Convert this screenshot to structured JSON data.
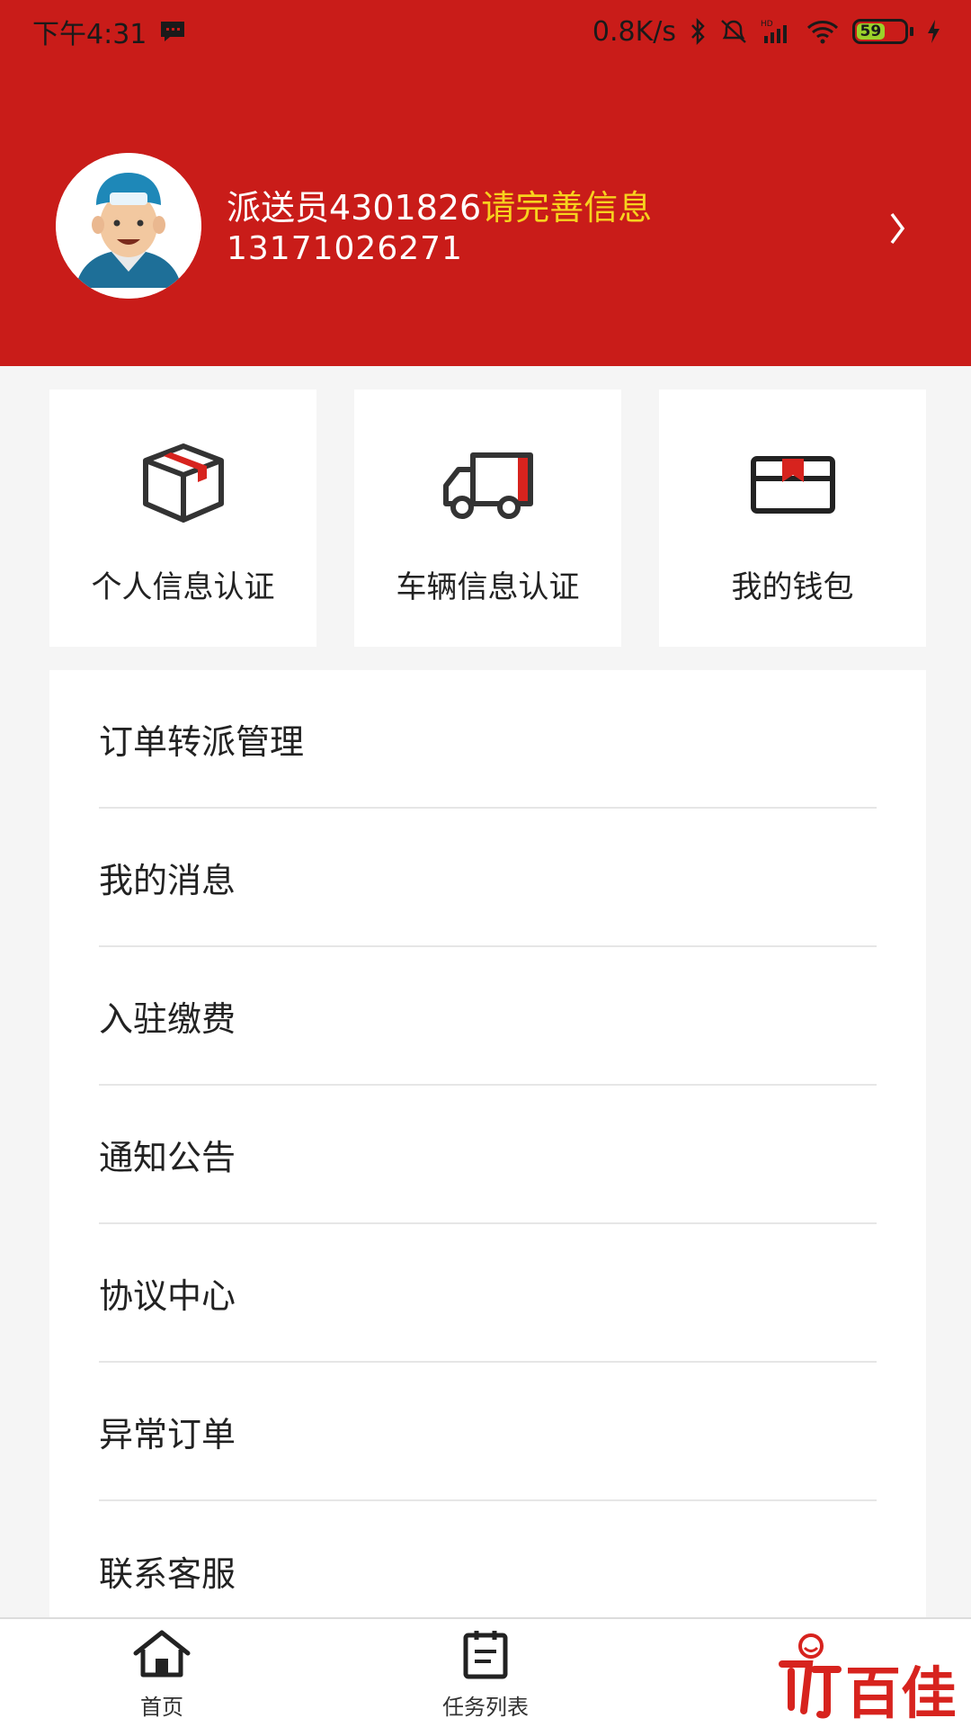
{
  "status_bar": {
    "time": "下午4:31",
    "network_speed": "0.8K/s",
    "battery": "59",
    "icons": [
      "message-icon",
      "bluetooth-icon",
      "alarm-off-icon",
      "hd-signal-icon",
      "wifi-icon",
      "battery-icon",
      "charging-icon"
    ]
  },
  "colors": {
    "header_bg": "#c91c19",
    "warn_text": "#f7d21e",
    "accent": "#c91c19"
  },
  "profile": {
    "name": "派送员4301826",
    "warning": "请完善信息",
    "phone": "13171026271"
  },
  "cards": [
    {
      "label": "个人信息认证",
      "icon": "package-box-icon"
    },
    {
      "label": "车辆信息认证",
      "icon": "truck-icon"
    },
    {
      "label": "我的钱包",
      "icon": "wallet-icon"
    }
  ],
  "menu": [
    {
      "label": "订单转派管理"
    },
    {
      "label": "我的消息"
    },
    {
      "label": "入驻缴费"
    },
    {
      "label": "通知公告"
    },
    {
      "label": "协议中心"
    },
    {
      "label": "异常订单"
    },
    {
      "label": "联系客服"
    }
  ],
  "bottom_nav": [
    {
      "label": "首页",
      "icon": "home-icon"
    },
    {
      "label": "任务列表",
      "icon": "task-list-icon"
    }
  ],
  "brand": {
    "text": "百佳"
  }
}
